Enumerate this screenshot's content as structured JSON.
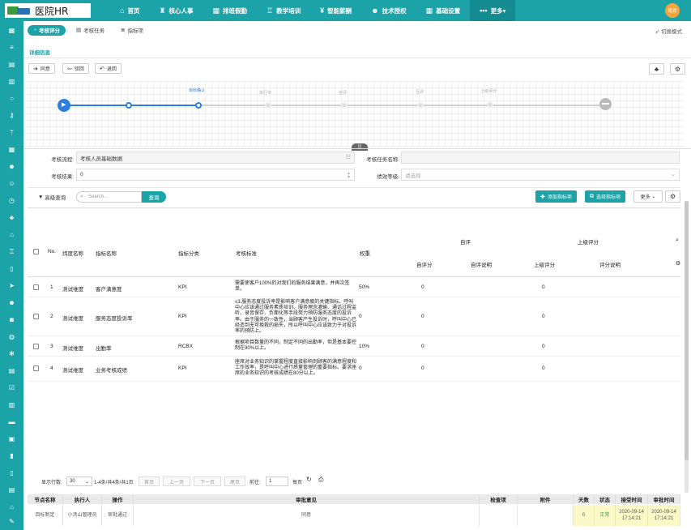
{
  "app": {
    "logo_text": "医院HR",
    "user_badge": "猪息"
  },
  "nav": [
    {
      "icon": "home-icon",
      "glyph": "⌂",
      "label": "首页"
    },
    {
      "icon": "org-icon",
      "glyph": "♜",
      "label": "核心人事"
    },
    {
      "icon": "calendar-icon",
      "glyph": "▦",
      "label": "排班假勤"
    },
    {
      "icon": "bank-icon",
      "glyph": "♖",
      "label": "教学培训"
    },
    {
      "icon": "yen-icon",
      "glyph": "¥",
      "label": "智能薪酬"
    },
    {
      "icon": "user-icon",
      "glyph": "☻",
      "label": "技术授权"
    },
    {
      "icon": "grid-icon",
      "glyph": "▦",
      "label": "基础设置"
    },
    {
      "icon": "more-icon",
      "glyph": "•••",
      "label": "更多▾"
    }
  ],
  "tabs": [
    {
      "icon": "gauge-icon",
      "glyph": "◔",
      "label": "考核评分"
    },
    {
      "icon": "list-icon",
      "glyph": "▤",
      "label": "考核任务"
    },
    {
      "icon": "stack-icon",
      "glyph": "≣",
      "label": "指标项"
    }
  ],
  "switch_mode": "切换模式",
  "subtab": "详细信息",
  "actions": {
    "approve": "同意",
    "back1": "驳回",
    "back2": "退回"
  },
  "flow": {
    "labels": [
      "目标确认",
      "执行中",
      "自评",
      "互评",
      "上级评分"
    ]
  },
  "form": {
    "process_label": "考核流程:",
    "process_value": "考核人员基础数据",
    "task_name_label": "考核任务名称:",
    "task_name_value": "",
    "result_label": "考核结果:",
    "result_value": "0",
    "grade_label": "绩效等级:",
    "grade_placeholder": "请选择"
  },
  "toolbar": {
    "advanced": "高级查询",
    "search_placeholder": "Search...",
    "query": "查询",
    "add": "添加指标项",
    "select": "选择指标项",
    "more": "更多"
  },
  "table": {
    "headers": {
      "no": "No.",
      "dimension": "纬度名称",
      "indicator": "指标名称",
      "category": "指标分类",
      "standard": "考核标准",
      "weight": "权重",
      "self_group": "自评",
      "self_score": "自评分",
      "self_note": "自评说明",
      "sup_group": "上级评分",
      "sup_score": "上级评分",
      "sup_note": "评分说明"
    },
    "rows": [
      {
        "no": "1",
        "dimension": "测试维度",
        "indicator": "客户满意度",
        "category": "KPI",
        "standard": "需要使客户100%的对我们的服务结果满意，并再次签单。",
        "weight": "50%",
        "self_score": "0",
        "sup_score": "0"
      },
      {
        "no": "2",
        "dimension": "测试维度",
        "indicator": "服务态度投诉率",
        "category": "KPI",
        "standard": "≤3.服务态度投诉率是影响客户满意度的关键指标，呼叫中心应该通过服务素质培训、服务理念灌输、通话过程监听、录音保存、负面化等手段努力预防服务态度的投诉率。由于服务的一致性，当顾客产生投诉时，呼叫中心已经造到无可挽救的损失，所以呼叫中心应该致力于对投诉率的预防上。",
        "weight": "0",
        "self_score": "0",
        "sup_score": "0"
      },
      {
        "no": "3",
        "dimension": "测试维度",
        "indicator": "出勤率",
        "category": "RCBX",
        "standard": "根据项目数量的不同，制定不同的出勤率，但是基本要控制在90%以上。",
        "weight": "10%",
        "self_score": "0",
        "sup_score": "0"
      },
      {
        "no": "4",
        "dimension": "测试维度",
        "indicator": "业务考核成绩",
        "category": "KPI",
        "standard": "座席对业务知识的掌握程度直接影响到顾客的满意程度和工作效率，是呼叫中心进行质量管理的重要指标。要求座席的业务知识的考核成绩在80分以上。",
        "weight": "0",
        "self_score": "0",
        "sup_score": "0"
      }
    ]
  },
  "pager": {
    "rows_label": "显示行数:",
    "rows_value": "30",
    "summary": "1-4条/共4条/共1页",
    "first": "首页",
    "prev": "上一页",
    "next": "下一页",
    "last": "尾页",
    "goto_label": "前往:",
    "goto_value": "1",
    "page_unit": "每页"
  },
  "approval": {
    "headers": [
      "节点名称",
      "执行人",
      "操作",
      "审批意见",
      "检查项",
      "附件",
      "天数",
      "状态",
      "接受时间",
      "审批时间"
    ],
    "row": [
      "目标制定",
      "小汤山管理员",
      "审批通过",
      "同意",
      "",
      "",
      "0",
      "正常",
      "2020-09-14 17:14:21",
      "2020-09-14 17:14:21"
    ]
  },
  "colors": {
    "brand": "#1ba3a8",
    "flow_active": "#2f7de1",
    "flow_pending": "#cccccc"
  }
}
